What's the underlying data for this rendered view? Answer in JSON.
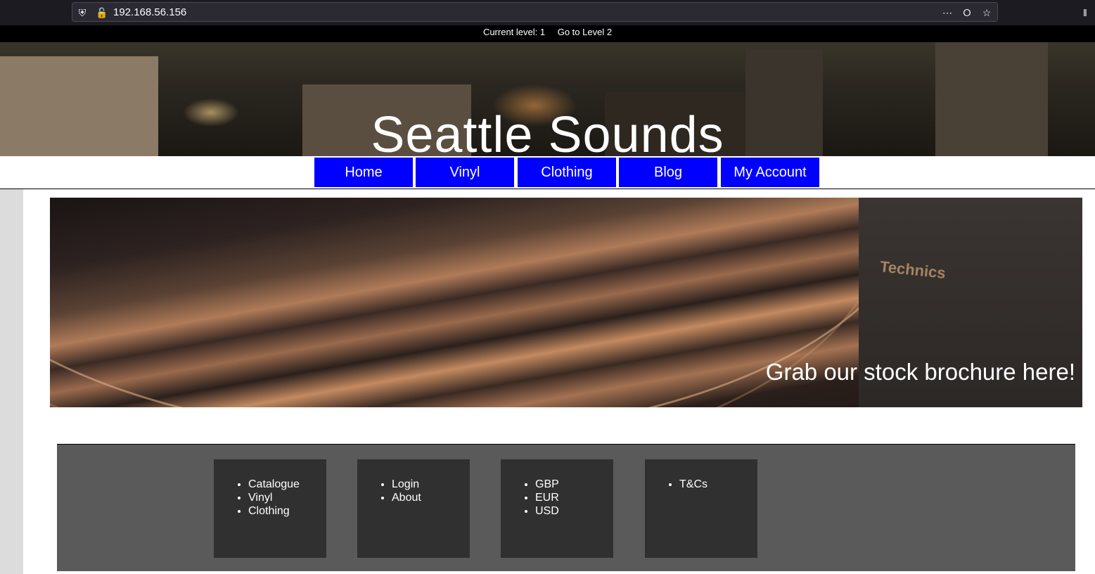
{
  "browser": {
    "url": "192.168.56.156",
    "icons": [
      "shield-icon",
      "insecure-lock-icon",
      "more-icon",
      "pocket-icon",
      "bookmark-star-icon",
      "library-icon"
    ]
  },
  "level_bar": {
    "current_level": "Current level: 1",
    "next_level_link": "Go to Level 2"
  },
  "header": {
    "title": "Seattle Sounds"
  },
  "nav": {
    "items": [
      {
        "label": "Home"
      },
      {
        "label": "Vinyl"
      },
      {
        "label": "Clothing"
      },
      {
        "label": "Blog"
      },
      {
        "label": "My Account"
      }
    ],
    "color": "#0000ff"
  },
  "hero": {
    "cta": "Grab our stock brochure here!",
    "brand_text": "Technics"
  },
  "footer": {
    "columns": [
      {
        "items": [
          "Catalogue",
          "Vinyl",
          "Clothing"
        ]
      },
      {
        "items": [
          "Login",
          "About"
        ]
      },
      {
        "items": [
          "GBP",
          "EUR",
          "USD"
        ]
      },
      {
        "items": [
          "T&Cs"
        ]
      }
    ]
  }
}
